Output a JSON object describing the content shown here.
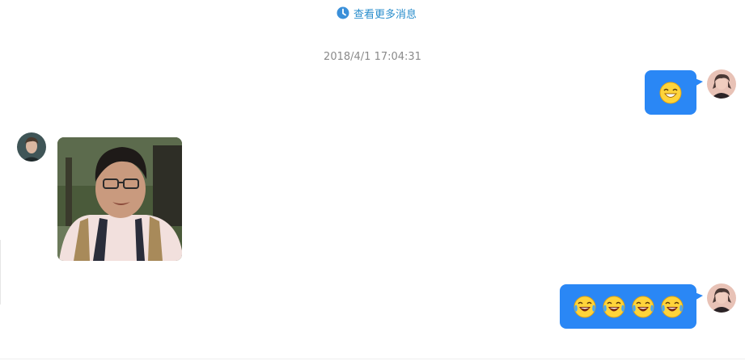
{
  "history": {
    "label": "查看更多消息",
    "icon": "clock-icon"
  },
  "conversation": {
    "timestamp": "2018/4/1 17:04:31",
    "messages": [
      {
        "side": "right",
        "type": "emoji",
        "emojis": [
          "smile-squint-emoji"
        ]
      },
      {
        "side": "left",
        "type": "image",
        "image": "portrait-photo"
      },
      {
        "side": "right",
        "type": "emoji",
        "emojis": [
          "tears-of-joy-emoji",
          "tears-of-joy-emoji",
          "tears-of-joy-emoji",
          "tears-of-joy-emoji"
        ]
      }
    ]
  },
  "colors": {
    "bubble": "#2a87f5",
    "link": "#2a8ecc",
    "timestamp": "#8a8a8a"
  }
}
